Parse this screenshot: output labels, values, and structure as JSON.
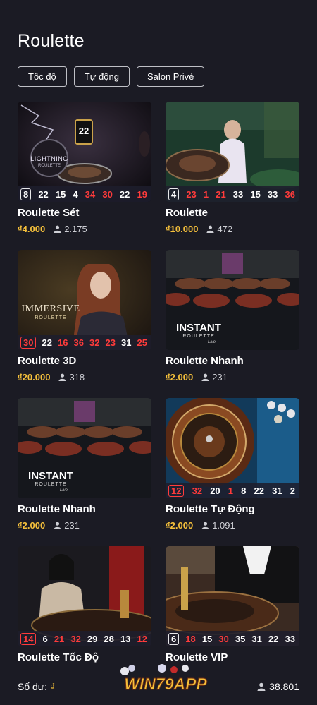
{
  "page": {
    "title": "Roulette"
  },
  "filters": [
    "Tốc độ",
    "Tự động",
    "Salon Privé"
  ],
  "games": [
    {
      "name": "Roulette Sét",
      "bet": "₫4.000",
      "players": "2.175",
      "numbers": [
        {
          "v": "8",
          "r": false
        },
        {
          "v": "22",
          "r": false
        },
        {
          "v": "15",
          "r": false
        },
        {
          "v": "4",
          "r": false
        },
        {
          "v": "34",
          "r": true
        },
        {
          "v": "30",
          "r": true
        },
        {
          "v": "22",
          "r": false
        },
        {
          "v": "19",
          "r": true
        }
      ]
    },
    {
      "name": "Roulette",
      "bet": "₫10.000",
      "players": "472",
      "numbers": [
        {
          "v": "4",
          "r": false
        },
        {
          "v": "23",
          "r": true
        },
        {
          "v": "1",
          "r": true
        },
        {
          "v": "21",
          "r": true
        },
        {
          "v": "33",
          "r": false
        },
        {
          "v": "15",
          "r": false
        },
        {
          "v": "33",
          "r": false
        },
        {
          "v": "36",
          "r": true
        }
      ]
    },
    {
      "name": "Roulette 3D",
      "bet": "₫20.000",
      "players": "318",
      "numbers": [
        {
          "v": "30",
          "r": true
        },
        {
          "v": "22",
          "r": false
        },
        {
          "v": "16",
          "r": true
        },
        {
          "v": "36",
          "r": true
        },
        {
          "v": "32",
          "r": true
        },
        {
          "v": "23",
          "r": true
        },
        {
          "v": "31",
          "r": false
        },
        {
          "v": "25",
          "r": true
        }
      ]
    },
    {
      "name": "Roulette Nhanh",
      "bet": "₫2.000",
      "players": "231",
      "numbers": []
    },
    {
      "name": "Roulette Nhanh",
      "bet": "₫2.000",
      "players": "231",
      "numbers": []
    },
    {
      "name": "Roulette Tự Động",
      "bet": "₫2.000",
      "players": "1.091",
      "numbers": [
        {
          "v": "12",
          "r": true
        },
        {
          "v": "32",
          "r": true
        },
        {
          "v": "20",
          "r": false
        },
        {
          "v": "1",
          "r": true
        },
        {
          "v": "8",
          "r": false
        },
        {
          "v": "22",
          "r": false
        },
        {
          "v": "31",
          "r": false
        },
        {
          "v": "2",
          "r": false
        }
      ]
    },
    {
      "name": "Roulette Tốc Độ",
      "bet": "",
      "players": "",
      "numbers": [
        {
          "v": "14",
          "r": true
        },
        {
          "v": "6",
          "r": false
        },
        {
          "v": "21",
          "r": true
        },
        {
          "v": "32",
          "r": true
        },
        {
          "v": "29",
          "r": false
        },
        {
          "v": "28",
          "r": false
        },
        {
          "v": "13",
          "r": false
        },
        {
          "v": "12",
          "r": true
        }
      ]
    },
    {
      "name": "Roulette VIP",
      "bet": "",
      "players": "",
      "numbers": [
        {
          "v": "6",
          "r": false
        },
        {
          "v": "18",
          "r": true
        },
        {
          "v": "15",
          "r": false
        },
        {
          "v": "30",
          "r": true
        },
        {
          "v": "35",
          "r": false
        },
        {
          "v": "31",
          "r": false
        },
        {
          "v": "22",
          "r": false
        },
        {
          "v": "33",
          "r": false
        }
      ]
    }
  ],
  "thumb_labels": {
    "lightning": "LIGHTNING",
    "lightning_sub": "ROULETTE",
    "multiplier": "22",
    "immersive": "IMMERSIVE",
    "immersive_sub": "ROULETTE",
    "instant": "INSTANT",
    "instant_sub": "ROULETTE",
    "instant_tag": "Live"
  },
  "footer": {
    "balance_label": "Số dư:",
    "currency": "₫",
    "online_count": "38.801",
    "logo_text": "WIN79APP"
  },
  "colors": {
    "background": "#1b1b24",
    "accent_gold": "#f5c03b",
    "red_number": "#ff3b3b"
  }
}
